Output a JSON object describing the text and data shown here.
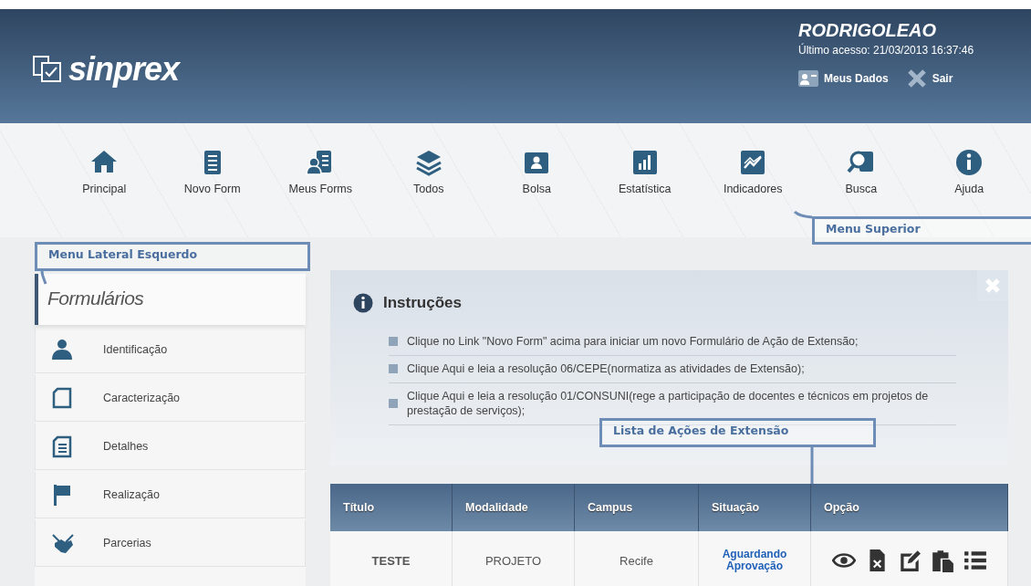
{
  "header": {
    "logo": "sinprex",
    "user": "RODRIGOLEAO",
    "last_access": "Último acesso: 21/03/2013 16:37:46",
    "actions": [
      "Meus Dados",
      "Sair"
    ]
  },
  "top_menu": {
    "items": [
      {
        "label": "Principal"
      },
      {
        "label": "Novo Form"
      },
      {
        "label": "Meus Forms"
      },
      {
        "label": "Todos"
      },
      {
        "label": "Bolsa"
      },
      {
        "label": "Estatística"
      },
      {
        "label": "Indicadores"
      },
      {
        "label": "Busca"
      },
      {
        "label": "Ajuda"
      }
    ]
  },
  "sidebar": {
    "title": "Formulários",
    "items": [
      {
        "label": "Identificação"
      },
      {
        "label": "Caracterização"
      },
      {
        "label": "Detalhes"
      },
      {
        "label": "Realização"
      },
      {
        "label": "Parcerias"
      }
    ]
  },
  "instructions": {
    "title": "Instruções",
    "items": [
      "Clique no Link \"Novo Form\" acima para iniciar um novo Formulário de Ação de Extensão;",
      "Clique Aqui e leia a resolução 06/CEPE(normatiza as atividades de Extensão);",
      "Clique Aqui e leia a resolução 01/CONSUNI(rege a participação de docentes e técnicos em projetos de prestação de serviços);"
    ]
  },
  "table": {
    "columns": [
      "Título",
      "Modalidade",
      "Campus",
      "Situação",
      "Opção"
    ],
    "rows": [
      {
        "cells": [
          "TESTE",
          "PROJETO",
          "Recife",
          "Aguardando Aprovação"
        ]
      }
    ]
  },
  "annotations": [
    {
      "label": "Menu Lateral Esquerdo"
    },
    {
      "label": "Menu Superior"
    },
    {
      "label": "Lista de Ações de Extensão"
    }
  ]
}
